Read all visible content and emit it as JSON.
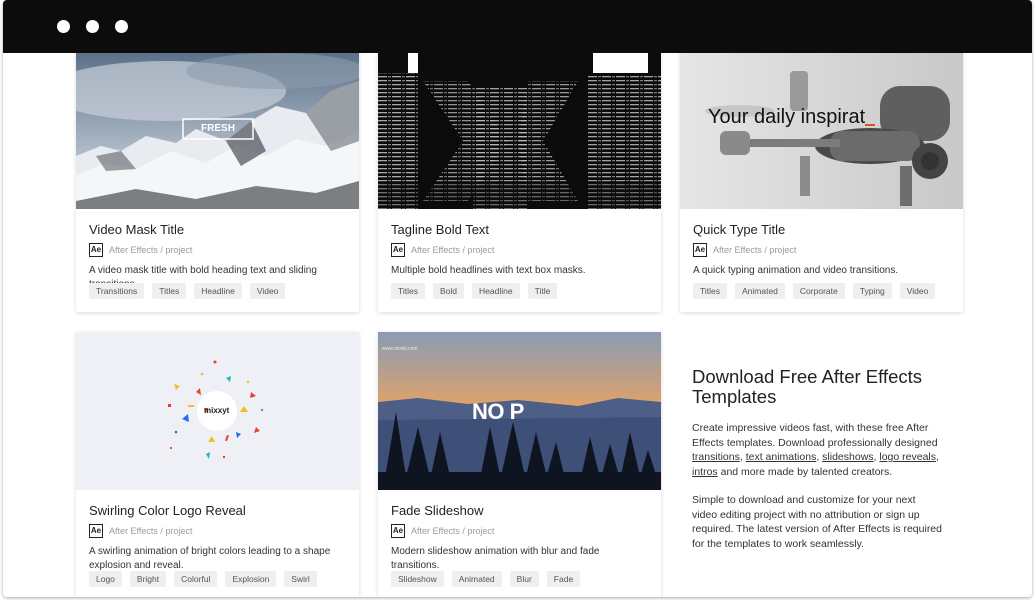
{
  "cards": [
    {
      "title": "Video Mask Title",
      "meta": "After Effects / project",
      "badge": "Ae",
      "description": "A video mask title with bold heading text and sliding transitions.",
      "tags": [
        "Transitions",
        "Titles",
        "Headline",
        "Video"
      ],
      "thumb_text": "FRESH"
    },
    {
      "title": "Tagline Bold Text",
      "meta": "After Effects / project",
      "badge": "Ae",
      "description": "Multiple bold headlines with text box masks.",
      "tags": [
        "Titles",
        "Bold",
        "Headline",
        "Title"
      ]
    },
    {
      "title": "Quick Type Title",
      "meta": "After Effects / project",
      "badge": "Ae",
      "description": "A quick typing animation and video transitions.",
      "tags": [
        "Titles",
        "Animated",
        "Corporate",
        "Typing",
        "Video"
      ],
      "thumb_text": "Your daily inspirat"
    },
    {
      "title": "Swirling Color Logo Reveal",
      "meta": "After Effects / project",
      "badge": "Ae",
      "description": "A swirling animation of bright colors leading to a shape explosion and reveal.",
      "tags": [
        "Logo",
        "Bright",
        "Colorful",
        "Explosion",
        "Swirl"
      ],
      "thumb_text": "mixxyt"
    },
    {
      "title": "Fade Slideshow",
      "meta": "After Effects / project",
      "badge": "Ae",
      "description": "Modern slideshow animation with blur and fade transitions.",
      "tags": [
        "Slideshow",
        "Animated",
        "Blur",
        "Fade"
      ],
      "thumb_text": "NO P",
      "thumb_small": "www.mixkit.com"
    }
  ],
  "info": {
    "title": "Download Free After Effects Templates",
    "p1_start": "Create impressive videos fast, with these free After Effects templates. Download professionally designed ",
    "links": [
      "transitions",
      "text animations",
      "slideshows",
      "logo reveals",
      "intros"
    ],
    "sep1": ", ",
    "sep2": ", ",
    "sep3": ", ",
    "sep4": ",",
    "p1_end": " and more made by talented creators.",
    "p2": "Simple to download and customize for your next video editing project with no attribution or sign up required. The latest version of After Effects is required for the templates to work seamlessly."
  }
}
